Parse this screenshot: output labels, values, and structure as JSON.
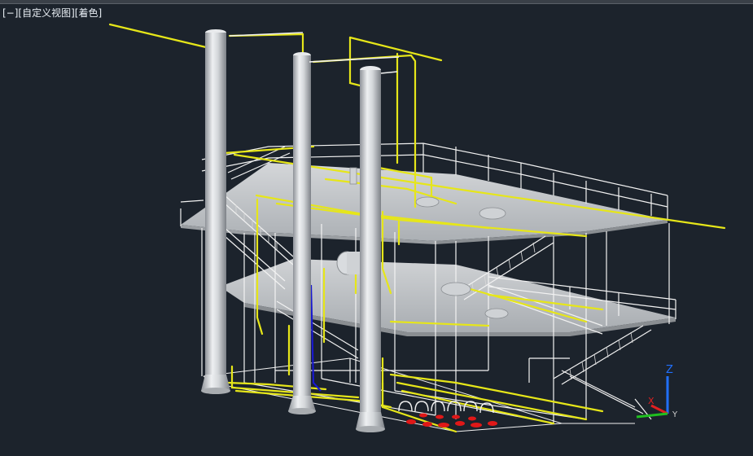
{
  "viewport": {
    "controls": {
      "viewport_menu": "[−]",
      "view_name": "[自定义视图]",
      "visual_style": "[着色]"
    },
    "ucs": {
      "x_label": "X",
      "y_label": "Y",
      "z_label": "Z"
    },
    "colors": {
      "background": "#1c232c",
      "pipe_yellow": "#e6e619",
      "steel_white": "#f2f2f2",
      "column_gray": "#c9ccd0",
      "valve_red": "#e01818",
      "vertical_blue": "#1818d0",
      "axis_x": "#e02020",
      "axis_y": "#20c020",
      "axis_z": "#2070ff"
    }
  }
}
